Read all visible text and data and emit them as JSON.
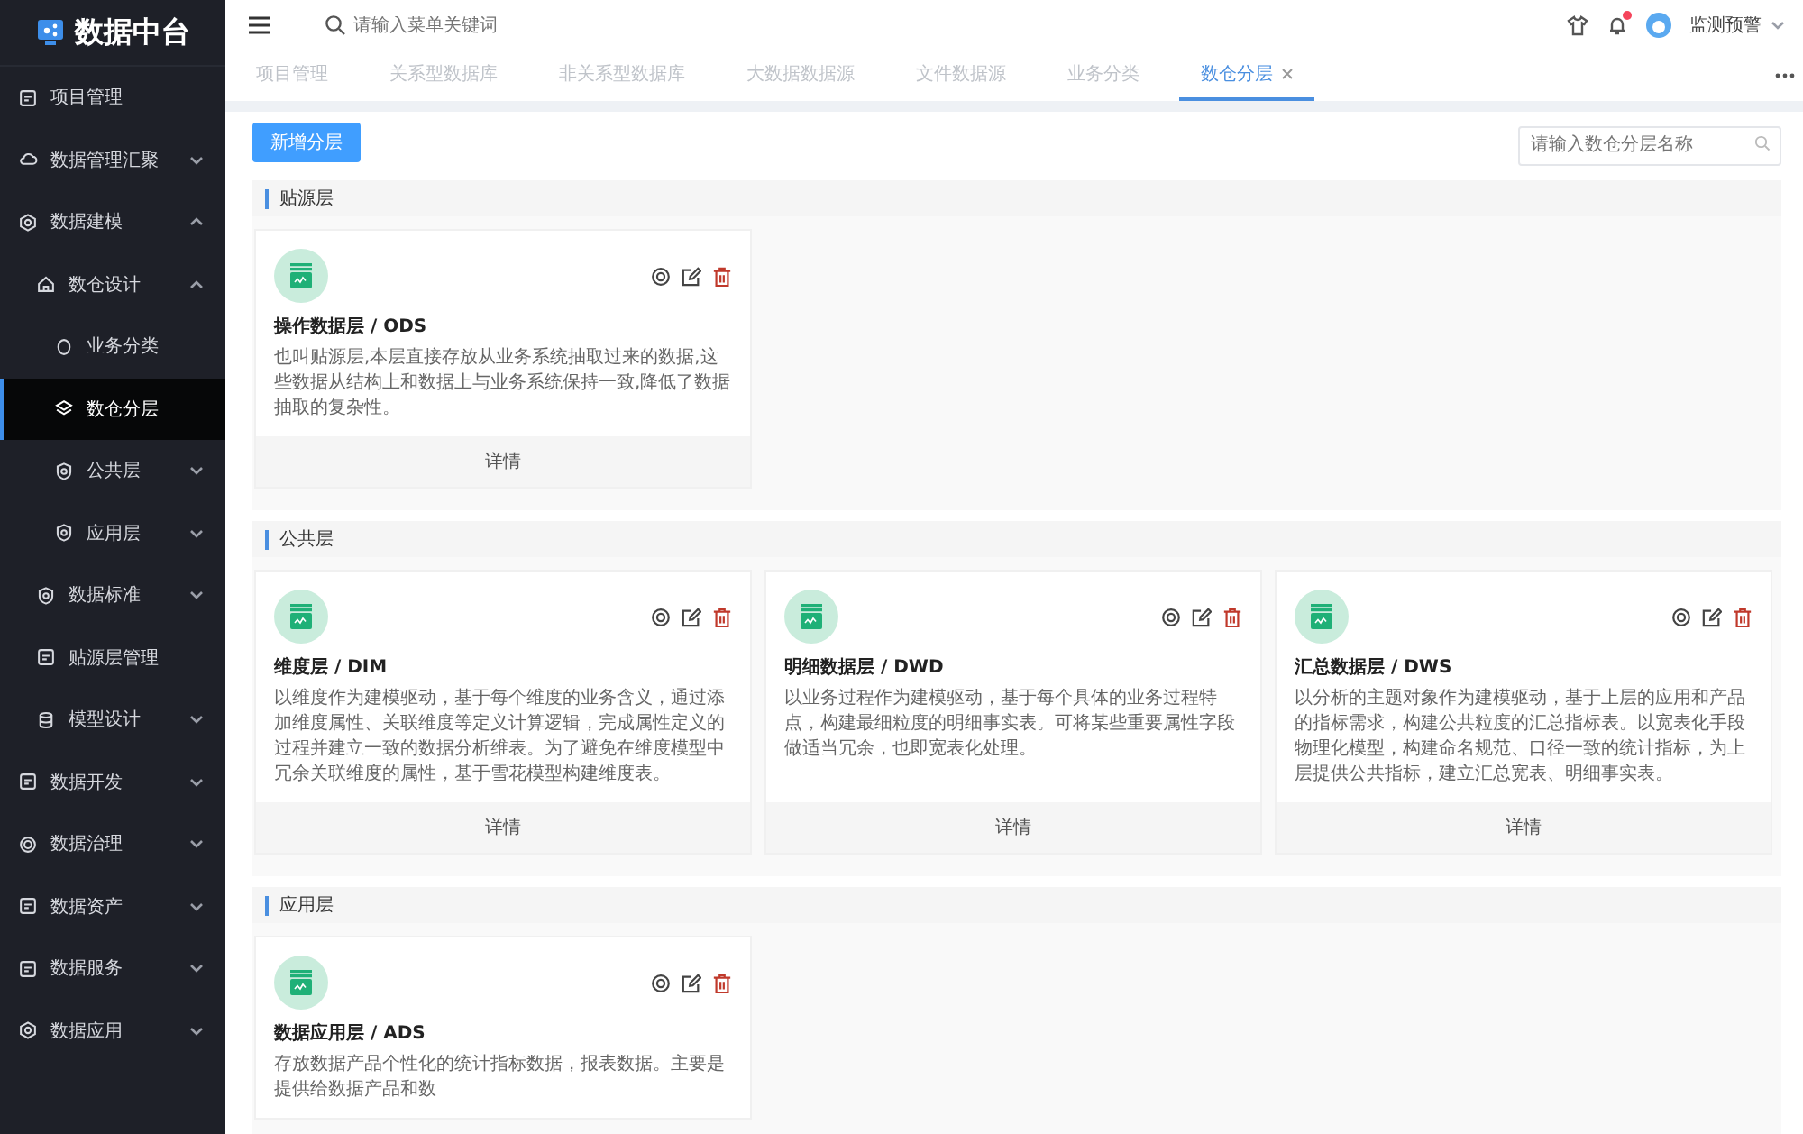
{
  "sidebar": {
    "logo": "数据中台",
    "items": [
      {
        "label": "项目管理",
        "kind": "leaf",
        "selected": false
      },
      {
        "label": "数据管理汇聚",
        "kind": "group",
        "expanded": false,
        "selected": false
      },
      {
        "label": "数据建模",
        "kind": "group",
        "expanded": true,
        "selected": false,
        "children": [
          {
            "label": "数仓设计",
            "kind": "group",
            "expanded": true,
            "selected": false,
            "children": [
              {
                "label": "业务分类",
                "kind": "leaf",
                "selected": false
              },
              {
                "label": "数仓分层",
                "kind": "leaf",
                "selected": true
              },
              {
                "label": "公共层",
                "kind": "group",
                "expanded": false,
                "selected": false
              },
              {
                "label": "应用层",
                "kind": "group",
                "expanded": false,
                "selected": false
              }
            ]
          },
          {
            "label": "数据标准",
            "kind": "group",
            "expanded": false,
            "selected": false
          },
          {
            "label": "贴源层管理",
            "kind": "leaf",
            "selected": false
          },
          {
            "label": "模型设计",
            "kind": "group",
            "expanded": false,
            "selected": false
          }
        ]
      },
      {
        "label": "数据开发",
        "kind": "group",
        "expanded": false,
        "selected": false
      },
      {
        "label": "数据治理",
        "kind": "group",
        "expanded": false,
        "selected": false
      },
      {
        "label": "数据资产",
        "kind": "group",
        "expanded": false,
        "selected": false
      },
      {
        "label": "数据服务",
        "kind": "group",
        "expanded": false,
        "selected": false
      },
      {
        "label": "数据应用",
        "kind": "group",
        "expanded": false,
        "selected": false
      }
    ]
  },
  "header": {
    "search": {
      "placeholder": "请输入菜单关键词"
    },
    "notification_badge": true,
    "user": "监测预警"
  },
  "tabs": [
    {
      "label": "项目管理",
      "selected": false
    },
    {
      "label": "关系型数据库",
      "selected": false
    },
    {
      "label": "非关系型数据库",
      "selected": false
    },
    {
      "label": "大数据数据源",
      "selected": false
    },
    {
      "label": "文件数据源",
      "selected": false
    },
    {
      "label": "业务分类",
      "selected": false
    },
    {
      "label": "数仓分层",
      "selected": true,
      "closable": true
    }
  ],
  "toolbar": {
    "add_button": "新增分层",
    "search": {
      "placeholder": "请输入数仓分层名称"
    }
  },
  "sections": [
    {
      "title": "贴源层",
      "cards": [
        {
          "title": "操作数据层 / ODS",
          "description": "也叫贴源层,本层直接存放从业务系统抽取过来的数据,这些数据从结构上和数据上与业务系统保持一致,降低了数据抽取的复杂性。",
          "footer": "详情"
        }
      ]
    },
    {
      "title": "公共层",
      "cards": [
        {
          "title": "维度层 / DIM",
          "description": "以维度作为建模驱动，基于每个维度的业务含义，通过添加维度属性、关联维度等定义计算逻辑，完成属性定义的过程并建立一致的数据分析维表。为了避免在维度模型中冗余关联维度的属性，基于雪花模型构建维度表。",
          "footer": "详情"
        },
        {
          "title": "明细数据层 / DWD",
          "description": "以业务过程作为建模驱动，基于每个具体的业务过程特点，构建最细粒度的明细事实表。可将某些重要属性字段做适当冗余，也即宽表化处理。",
          "footer": "详情"
        },
        {
          "title": "汇总数据层 / DWS",
          "description": "以分析的主题对象作为建模驱动，基于上层的应用和产品的指标需求，构建公共粒度的汇总指标表。以宽表化手段物理化模型，构建命名规范、口径一致的统计指标，为上层提供公共指标，建立汇总宽表、明细事实表。",
          "footer": "详情"
        }
      ]
    },
    {
      "title": "应用层",
      "cards": [
        {
          "title": "数据应用层 / ADS",
          "description": "存放数据产品个性化的统计指标数据，报表数据。主要是提供给数据产品和数"
        }
      ]
    }
  ]
}
